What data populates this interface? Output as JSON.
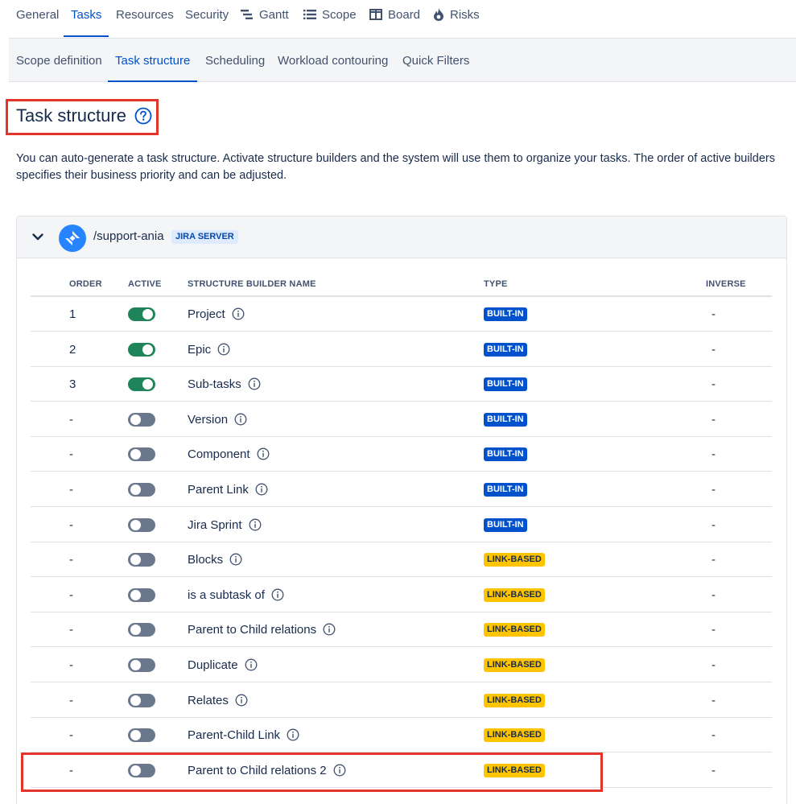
{
  "top_tabs": [
    {
      "label": "General",
      "icon": ""
    },
    {
      "label": "Tasks",
      "icon": "",
      "active": true
    },
    {
      "label": "Resources",
      "icon": ""
    },
    {
      "label": "Security",
      "icon": ""
    },
    {
      "label": "Gantt",
      "icon": "gantt-icon"
    },
    {
      "label": "Scope",
      "icon": "list-icon"
    },
    {
      "label": "Board",
      "icon": "board-icon"
    },
    {
      "label": "Risks",
      "icon": "flame-icon"
    }
  ],
  "sub_tabs": [
    {
      "label": "Scope definition"
    },
    {
      "label": "Task structure",
      "active": true
    },
    {
      "label": "Scheduling"
    },
    {
      "label": "Workload contouring"
    },
    {
      "label": "Quick Filters"
    }
  ],
  "page": {
    "title": "Task structure",
    "description": "You can auto-generate a task structure. Activate structure builders and the system will use them to organize your tasks. The order of active builders specifies their business priority and can be adjusted."
  },
  "source": {
    "name": "/support-ania",
    "badge": "JIRA SERVER"
  },
  "table": {
    "headers": {
      "order": "ORDER",
      "active": "ACTIVE",
      "name": "STRUCTURE BUILDER NAME",
      "type": "TYPE",
      "inverse": "INVERSE"
    },
    "rows": [
      {
        "order": "1",
        "active": true,
        "name": "Project",
        "type": "BUILT-IN",
        "inverse": "-"
      },
      {
        "order": "2",
        "active": true,
        "name": "Epic",
        "type": "BUILT-IN",
        "inverse": "-"
      },
      {
        "order": "3",
        "active": true,
        "name": "Sub-tasks",
        "type": "BUILT-IN",
        "inverse": "-"
      },
      {
        "order": "-",
        "active": false,
        "name": "Version",
        "type": "BUILT-IN",
        "inverse": "-"
      },
      {
        "order": "-",
        "active": false,
        "name": "Component",
        "type": "BUILT-IN",
        "inverse": "-"
      },
      {
        "order": "-",
        "active": false,
        "name": "Parent Link",
        "type": "BUILT-IN",
        "inverse": "-"
      },
      {
        "order": "-",
        "active": false,
        "name": "Jira Sprint",
        "type": "BUILT-IN",
        "inverse": "-"
      },
      {
        "order": "-",
        "active": false,
        "name": "Blocks",
        "type": "LINK-BASED",
        "inverse": "-"
      },
      {
        "order": "-",
        "active": false,
        "name": "is a subtask of",
        "type": "LINK-BASED",
        "inverse": "-"
      },
      {
        "order": "-",
        "active": false,
        "name": "Parent to Child relations",
        "type": "LINK-BASED",
        "inverse": "-"
      },
      {
        "order": "-",
        "active": false,
        "name": "Duplicate",
        "type": "LINK-BASED",
        "inverse": "-"
      },
      {
        "order": "-",
        "active": false,
        "name": "Relates",
        "type": "LINK-BASED",
        "inverse": "-"
      },
      {
        "order": "-",
        "active": false,
        "name": "Parent-Child Link",
        "type": "LINK-BASED",
        "inverse": "-"
      },
      {
        "order": "-",
        "active": false,
        "name": "Parent to Child relations 2",
        "type": "LINK-BASED",
        "inverse": "-"
      }
    ]
  },
  "colors": {
    "accent": "#0052cc",
    "toggle_on": "#1f845a",
    "toggle_off": "#6b778c",
    "builtin_badge": "#0052cc",
    "link_badge": "#ffc400",
    "highlight": "#e5342a"
  }
}
